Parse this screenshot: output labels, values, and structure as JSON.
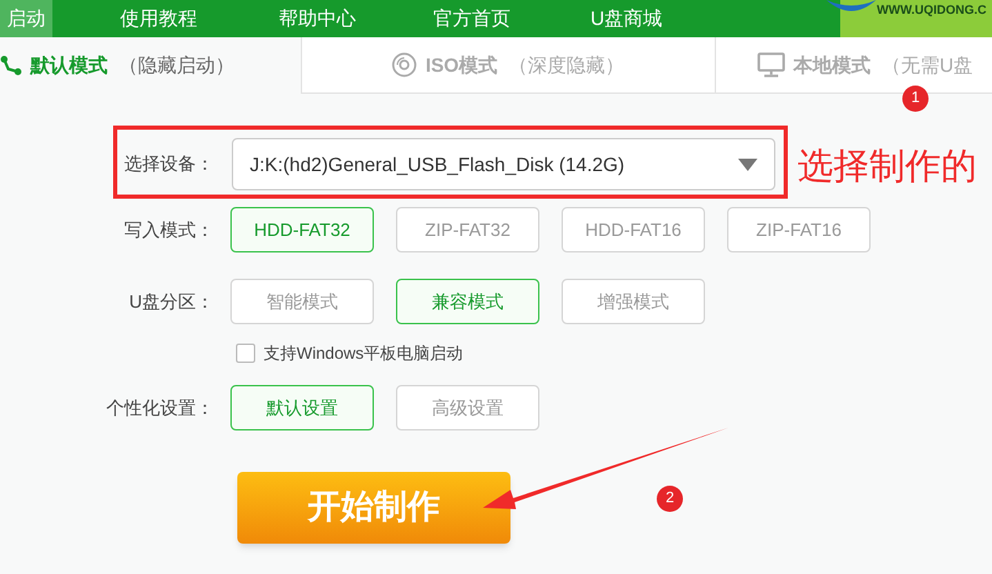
{
  "nav": {
    "items": [
      {
        "label": "启动",
        "selected": true
      },
      {
        "label": "使用教程",
        "selected": false
      },
      {
        "label": "帮助中心",
        "selected": false
      },
      {
        "label": "官方首页",
        "selected": false
      },
      {
        "label": "U盘商城",
        "selected": false
      }
    ],
    "logo_text": "WWW.UQIDONG.C"
  },
  "mode_tabs": [
    {
      "kind": "default",
      "title": "默认模式",
      "subtitle": "（隐藏启动）",
      "selected": true
    },
    {
      "kind": "iso",
      "title": "ISO模式",
      "subtitle": "（深度隐藏）",
      "selected": false
    },
    {
      "kind": "local",
      "title": "本地模式",
      "subtitle": "（无需U盘",
      "selected": false
    }
  ],
  "device": {
    "label": "选择设备：",
    "value": "J:K:(hd2)General_USB_Flash_Disk (14.2G)"
  },
  "option_rows": [
    {
      "label": "写入模式：",
      "options": [
        {
          "label": "HDD-FAT32",
          "selected": true
        },
        {
          "label": "ZIP-FAT32",
          "selected": false
        },
        {
          "label": "HDD-FAT16",
          "selected": false
        },
        {
          "label": "ZIP-FAT16",
          "selected": false
        }
      ]
    },
    {
      "label": "U盘分区：",
      "options": [
        {
          "label": "智能模式",
          "selected": false
        },
        {
          "label": "兼容模式",
          "selected": true
        },
        {
          "label": "增强模式",
          "selected": false
        }
      ]
    }
  ],
  "tablet_boot": {
    "label": "支持Windows平板电脑启动",
    "checked": false
  },
  "personalization": {
    "label": "个性化设置：",
    "options": [
      {
        "label": "默认设置",
        "selected": true
      },
      {
        "label": "高级设置",
        "selected": false
      }
    ]
  },
  "start_button": "开始制作",
  "annotations": {
    "callout": "选择制作的",
    "badges": [
      "1",
      "2"
    ]
  }
}
